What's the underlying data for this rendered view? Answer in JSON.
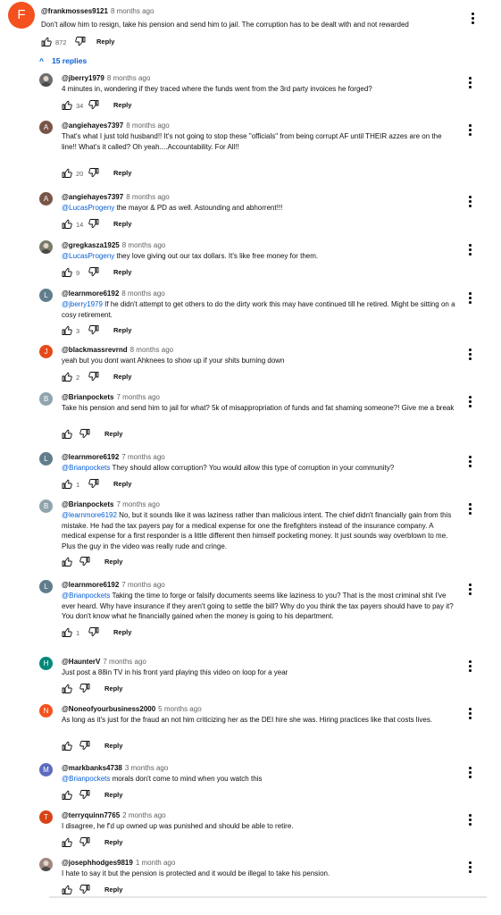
{
  "top_comment": {
    "avatar_letter": "F",
    "avatar_color": "#f4511e",
    "author": "@frankmosses9121",
    "time": "8 months ago",
    "text": "Don't allow him to resign, take his pension and send him to jail. The corruption has to be dealt with and not rewarded",
    "likes": "872",
    "reply_label": "Reply"
  },
  "replies_toggle": {
    "chevron": "^",
    "label": "15 replies"
  },
  "replies": [
    {
      "author": "@jberry1979",
      "time": "8 months ago",
      "avatar_letter": "",
      "avatar_color": "#6d6d6d",
      "mention": "",
      "text": "4 minutes in, wondering if they traced where the funds went from the 3rd party invoices he forged?",
      "likes": "34",
      "reply_label": "Reply"
    },
    {
      "author": "@angiehayes7397",
      "time": "8 months ago",
      "avatar_letter": "A",
      "avatar_color": "#795548",
      "mention": "",
      "text": "That's what I just told husband!! It's not going to stop these \"officials\" from being corrupt AF until THEIR azzes are on the line!! What's it called? Oh yeah....Accountability. For All!!",
      "likes": "20",
      "reply_label": "Reply"
    },
    {
      "author": "@angiehayes7397",
      "time": "8 months ago",
      "avatar_letter": "A",
      "avatar_color": "#795548",
      "mention": "@LucasProgeny",
      "text": " the mayor & PD as well. Astounding and abhorrent!!!",
      "likes": "14",
      "reply_label": "Reply"
    },
    {
      "author": "@gregkasza1925",
      "time": "8 months ago",
      "avatar_letter": "",
      "avatar_color": "#7a7a6a",
      "mention": "@LucasProgeny",
      "text": " they love giving out our tax dollars.  It's like free money for them.",
      "likes": "9",
      "reply_label": "Reply"
    },
    {
      "author": "@learnmore6192",
      "time": "8 months ago",
      "avatar_letter": "L",
      "avatar_color": "#607d8b",
      "mention": "@jberry1979",
      "text": "  If he didn't attempt to get others to do the dirty work this may have continued till he retired. Might be sitting on a cosy retirement.",
      "likes": "3",
      "reply_label": "Reply"
    },
    {
      "author": "@blackmassrevrnd",
      "time": "8 months ago",
      "avatar_letter": "J",
      "avatar_color": "#e64a19",
      "mention": "",
      "text": "yeah but you dont want Ahknees to show up if your shits burning down",
      "likes": "2",
      "reply_label": "Reply"
    },
    {
      "author": "@Brianpockets",
      "time": "7 months ago",
      "avatar_letter": "B",
      "avatar_color": "#90a4ae",
      "mention": "",
      "text": "Take his pension and send him to jail for what?  5k of misappropriation of funds and fat shaming someone?!  Give me a break",
      "likes": "",
      "reply_label": "Reply"
    },
    {
      "author": "@learnmore6192",
      "time": "7 months ago",
      "avatar_letter": "L",
      "avatar_color": "#607d8b",
      "mention": "@Brianpockets",
      "text": "  They should allow corruption? You would allow this type of corruption in your community?",
      "likes": "1",
      "reply_label": "Reply"
    },
    {
      "author": "@Brianpockets",
      "time": "7 months ago",
      "avatar_letter": "B",
      "avatar_color": "#90a4ae",
      "mention": "@learnmore6192",
      "text": "  No, but it sounds like it was laziness rather than malicious intent.  The chief didn't financially gain from this mistake.  He had the tax payers pay for a medical expense for one the firefighters instead of the insurance company.  A medical expense for a first responder is a little different then himself pocketing money.  It just sounds way overblown to me.  Plus the guy in the video was really rude and cringe.",
      "likes": "",
      "reply_label": "Reply"
    },
    {
      "author": "@learnmore6192",
      "time": "7 months ago",
      "avatar_letter": "L",
      "avatar_color": "#607d8b",
      "mention": "@Brianpockets",
      "text": "  Taking the time to forge or falsify documents seems like laziness to you? That is the most criminal shit I've ever heard. Why have insurance if they aren't going to settle the bill? Why do you think the tax payers should have to pay it? You don't know what he financially gained when the money is going to his department.",
      "likes": "1",
      "reply_label": "Reply"
    },
    {
      "author": "@HaunterV",
      "time": "7 months ago",
      "avatar_letter": "H",
      "avatar_color": "#00897b",
      "mention": "",
      "text": "Just post a 88in TV in his front yard playing this video on loop for a year",
      "likes": "",
      "reply_label": "Reply"
    },
    {
      "author": "@Noneofyourbusiness2000",
      "time": "5 months ago",
      "avatar_letter": "N",
      "avatar_color": "#f4511e",
      "mention": "",
      "text": "As long as it's just for the fraud an not him criticizing her as the DEI hire she was. Hiring practices like that costs lives.",
      "likes": "",
      "reply_label": "Reply"
    },
    {
      "author": "@markbanks4738",
      "time": "3 months ago",
      "avatar_letter": "M",
      "avatar_color": "#5c6bc0",
      "mention": "@Brianpockets",
      "text": " morals don't come to mind when you watch this",
      "likes": "",
      "reply_label": "Reply"
    },
    {
      "author": "@terryquinn7765",
      "time": "2 months ago",
      "avatar_letter": "T",
      "avatar_color": "#d84315",
      "mention": "",
      "text": "I disagree, he f'd up owned up was punished and should be able to retire.",
      "likes": "",
      "reply_label": "Reply"
    },
    {
      "author": "@josephhodges9819",
      "time": "1 month ago",
      "avatar_letter": "",
      "avatar_color": "#a1887f",
      "mention": "",
      "text": "I hate to say it but the pension is protected and it would be illegal to take his pension.",
      "likes": "",
      "reply_label": "Reply"
    }
  ],
  "icons": {
    "like": "thumbs-up-icon",
    "dislike": "thumbs-down-icon",
    "menu": "more-vert-icon"
  }
}
